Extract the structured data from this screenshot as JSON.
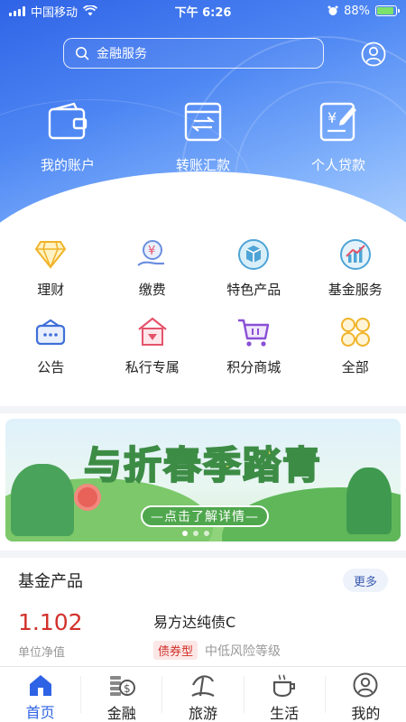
{
  "status_bar": {
    "carrier": "中国移动",
    "time": "下午 6:26",
    "battery": "88%",
    "battery_level": 0.88
  },
  "search": {
    "placeholder": "金融服务"
  },
  "hero_actions": [
    {
      "label": "我的账户",
      "icon": "wallet-icon"
    },
    {
      "label": "转账汇款",
      "icon": "transfer-icon"
    },
    {
      "label": "个人贷款",
      "icon": "loan-icon"
    }
  ],
  "services": [
    {
      "label": "理财",
      "icon": "diamond-icon"
    },
    {
      "label": "缴费",
      "icon": "payment-icon"
    },
    {
      "label": "特色产品",
      "icon": "cube-icon"
    },
    {
      "label": "基金服务",
      "icon": "chart-icon"
    },
    {
      "label": "公告",
      "icon": "announcement-icon"
    },
    {
      "label": "私行专属",
      "icon": "private-bank-icon"
    },
    {
      "label": "积分商城",
      "icon": "cart-icon"
    },
    {
      "label": "全部",
      "icon": "all-icon"
    }
  ],
  "banner": {
    "title": "与折春季踏青",
    "cta": "—点击了解详情—"
  },
  "fund": {
    "section_title": "基金产品",
    "more_label": "更多",
    "nav_value": "1.102",
    "nav_label": "单位净值",
    "name": "易方达纯债C",
    "type_tag": "债券型",
    "risk": "中低风险等级"
  },
  "tabs": [
    {
      "label": "首页",
      "icon": "home-icon",
      "active": true
    },
    {
      "label": "金融",
      "icon": "finance-icon",
      "active": false
    },
    {
      "label": "旅游",
      "icon": "travel-icon",
      "active": false
    },
    {
      "label": "生活",
      "icon": "coffee-icon",
      "active": false
    },
    {
      "label": "我的",
      "icon": "profile-icon",
      "active": false
    }
  ],
  "colors": {
    "primary": "#2f63e6",
    "nav_value": "#d2312b"
  }
}
